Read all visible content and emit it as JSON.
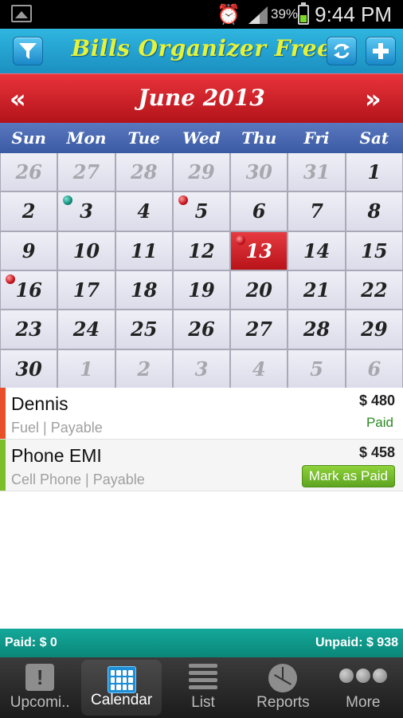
{
  "status_bar": {
    "battery_percent": "39%",
    "time": "9:44 PM",
    "icons": [
      "gallery-icon",
      "alarm-icon",
      "signal-icon",
      "battery-icon"
    ]
  },
  "header": {
    "title": "Bills Organizer Free",
    "icons": [
      "filter-icon",
      "sync-icon",
      "add-icon"
    ]
  },
  "calendar": {
    "month_label": "June 2013",
    "prev_label": "«",
    "next_label": "»",
    "weekdays": [
      "Sun",
      "Mon",
      "Tue",
      "Wed",
      "Thu",
      "Fri",
      "Sat"
    ],
    "days": [
      {
        "day": "26",
        "other": true
      },
      {
        "day": "27",
        "other": true
      },
      {
        "day": "28",
        "other": true
      },
      {
        "day": "29",
        "other": true
      },
      {
        "day": "30",
        "other": true
      },
      {
        "day": "31",
        "other": true
      },
      {
        "day": "1"
      },
      {
        "day": "2"
      },
      {
        "day": "3",
        "marker": "teal"
      },
      {
        "day": "4"
      },
      {
        "day": "5",
        "marker": "red"
      },
      {
        "day": "6"
      },
      {
        "day": "7"
      },
      {
        "day": "8"
      },
      {
        "day": "9"
      },
      {
        "day": "10"
      },
      {
        "day": "11"
      },
      {
        "day": "12"
      },
      {
        "day": "13",
        "today": true,
        "marker": "red"
      },
      {
        "day": "14"
      },
      {
        "day": "15"
      },
      {
        "day": "16",
        "marker": "red"
      },
      {
        "day": "17"
      },
      {
        "day": "18"
      },
      {
        "day": "19"
      },
      {
        "day": "20"
      },
      {
        "day": "21"
      },
      {
        "day": "22"
      },
      {
        "day": "23"
      },
      {
        "day": "24"
      },
      {
        "day": "25"
      },
      {
        "day": "26"
      },
      {
        "day": "27"
      },
      {
        "day": "28"
      },
      {
        "day": "29"
      },
      {
        "day": "30"
      },
      {
        "day": "1",
        "other": true
      },
      {
        "day": "2",
        "other": true
      },
      {
        "day": "3",
        "other": true
      },
      {
        "day": "4",
        "other": true
      },
      {
        "day": "5",
        "other": true
      },
      {
        "day": "6",
        "other": true
      }
    ]
  },
  "bills": [
    {
      "name": "Dennis",
      "meta": "Fuel | Payable",
      "amount": "$ 480",
      "status": "Paid",
      "color": "#e8502a"
    },
    {
      "name": "Phone EMI",
      "meta": "Cell Phone | Payable",
      "amount": "$ 458",
      "action": "Mark as Paid",
      "color": "#7cbd2a"
    }
  ],
  "totals": {
    "paid": "Paid: $ 0",
    "unpaid": "Unpaid: $ 938"
  },
  "nav": {
    "items": [
      {
        "label": "Upcomi..",
        "icon": "upcoming-icon"
      },
      {
        "label": "Calendar",
        "icon": "calendar-icon",
        "active": true
      },
      {
        "label": "List",
        "icon": "list-icon"
      },
      {
        "label": "Reports",
        "icon": "reports-icon"
      },
      {
        "label": "More",
        "icon": "more-icon"
      }
    ]
  },
  "colors": {
    "header": "#1fa0d2",
    "title": "#e6f23a",
    "month_bar": "#c8161d",
    "weekday_bar": "#4664ad",
    "totals_bar": "#0d9686"
  }
}
